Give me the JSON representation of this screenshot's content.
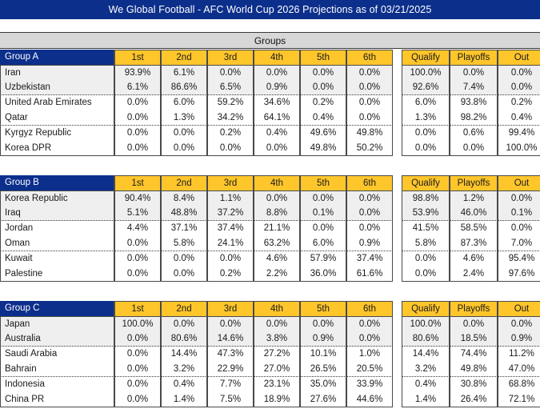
{
  "title": "We Global Football - AFC World Cup 2026 Projections as of 03/21/2025",
  "section_header": "Groups",
  "colors": {
    "title_bar": "#0c2f8c",
    "group_header": "#0c2f8c",
    "column_header": "#ffc62b",
    "section_band": "#d7d7d7",
    "row_shade": "#efefef"
  },
  "columns": {
    "place": [
      "1st",
      "2nd",
      "3rd",
      "4th",
      "5th",
      "6th"
    ],
    "outcome": [
      "Qualify",
      "Playoffs",
      "Out"
    ]
  },
  "groups": [
    {
      "label": "Group A",
      "rows": [
        {
          "team": "Iran",
          "place": [
            "93.9%",
            "6.1%",
            "0.0%",
            "0.0%",
            "0.0%",
            "0.0%"
          ],
          "outcome": [
            "100.0%",
            "0.0%",
            "0.0%"
          ]
        },
        {
          "team": "Uzbekistan",
          "place": [
            "6.1%",
            "86.6%",
            "6.5%",
            "0.9%",
            "0.0%",
            "0.0%"
          ],
          "outcome": [
            "92.6%",
            "7.4%",
            "0.0%"
          ]
        },
        {
          "team": "United Arab Emirates",
          "place": [
            "0.0%",
            "6.0%",
            "59.2%",
            "34.6%",
            "0.2%",
            "0.0%"
          ],
          "outcome": [
            "6.0%",
            "93.8%",
            "0.2%"
          ]
        },
        {
          "team": "Qatar",
          "place": [
            "0.0%",
            "1.3%",
            "34.2%",
            "64.1%",
            "0.4%",
            "0.0%"
          ],
          "outcome": [
            "1.3%",
            "98.2%",
            "0.4%"
          ]
        },
        {
          "team": "Kyrgyz Republic",
          "place": [
            "0.0%",
            "0.0%",
            "0.2%",
            "0.4%",
            "49.6%",
            "49.8%"
          ],
          "outcome": [
            "0.0%",
            "0.6%",
            "99.4%"
          ]
        },
        {
          "team": "Korea DPR",
          "place": [
            "0.0%",
            "0.0%",
            "0.0%",
            "0.0%",
            "49.8%",
            "50.2%"
          ],
          "outcome": [
            "0.0%",
            "0.0%",
            "100.0%"
          ]
        }
      ]
    },
    {
      "label": "Group B",
      "rows": [
        {
          "team": "Korea Republic",
          "place": [
            "90.4%",
            "8.4%",
            "1.1%",
            "0.0%",
            "0.0%",
            "0.0%"
          ],
          "outcome": [
            "98.8%",
            "1.2%",
            "0.0%"
          ]
        },
        {
          "team": "Iraq",
          "place": [
            "5.1%",
            "48.8%",
            "37.2%",
            "8.8%",
            "0.1%",
            "0.0%"
          ],
          "outcome": [
            "53.9%",
            "46.0%",
            "0.1%"
          ]
        },
        {
          "team": "Jordan",
          "place": [
            "4.4%",
            "37.1%",
            "37.4%",
            "21.1%",
            "0.0%",
            "0.0%"
          ],
          "outcome": [
            "41.5%",
            "58.5%",
            "0.0%"
          ]
        },
        {
          "team": "Oman",
          "place": [
            "0.0%",
            "5.8%",
            "24.1%",
            "63.2%",
            "6.0%",
            "0.9%"
          ],
          "outcome": [
            "5.8%",
            "87.3%",
            "7.0%"
          ]
        },
        {
          "team": "Kuwait",
          "place": [
            "0.0%",
            "0.0%",
            "0.0%",
            "4.6%",
            "57.9%",
            "37.4%"
          ],
          "outcome": [
            "0.0%",
            "4.6%",
            "95.4%"
          ]
        },
        {
          "team": "Palestine",
          "place": [
            "0.0%",
            "0.0%",
            "0.2%",
            "2.2%",
            "36.0%",
            "61.6%"
          ],
          "outcome": [
            "0.0%",
            "2.4%",
            "97.6%"
          ]
        }
      ]
    },
    {
      "label": "Group C",
      "rows": [
        {
          "team": "Japan",
          "place": [
            "100.0%",
            "0.0%",
            "0.0%",
            "0.0%",
            "0.0%",
            "0.0%"
          ],
          "outcome": [
            "100.0%",
            "0.0%",
            "0.0%"
          ]
        },
        {
          "team": "Australia",
          "place": [
            "0.0%",
            "80.6%",
            "14.6%",
            "3.8%",
            "0.9%",
            "0.0%"
          ],
          "outcome": [
            "80.6%",
            "18.5%",
            "0.9%"
          ]
        },
        {
          "team": "Saudi Arabia",
          "place": [
            "0.0%",
            "14.4%",
            "47.3%",
            "27.2%",
            "10.1%",
            "1.0%"
          ],
          "outcome": [
            "14.4%",
            "74.4%",
            "11.2%"
          ]
        },
        {
          "team": "Bahrain",
          "place": [
            "0.0%",
            "3.2%",
            "22.9%",
            "27.0%",
            "26.5%",
            "20.5%"
          ],
          "outcome": [
            "3.2%",
            "49.8%",
            "47.0%"
          ]
        },
        {
          "team": "Indonesia",
          "place": [
            "0.0%",
            "0.4%",
            "7.7%",
            "23.1%",
            "35.0%",
            "33.9%"
          ],
          "outcome": [
            "0.4%",
            "30.8%",
            "68.8%"
          ]
        },
        {
          "team": "China PR",
          "place": [
            "0.0%",
            "1.4%",
            "7.5%",
            "18.9%",
            "27.6%",
            "44.6%"
          ],
          "outcome": [
            "1.4%",
            "26.4%",
            "72.1%"
          ]
        }
      ]
    }
  ]
}
